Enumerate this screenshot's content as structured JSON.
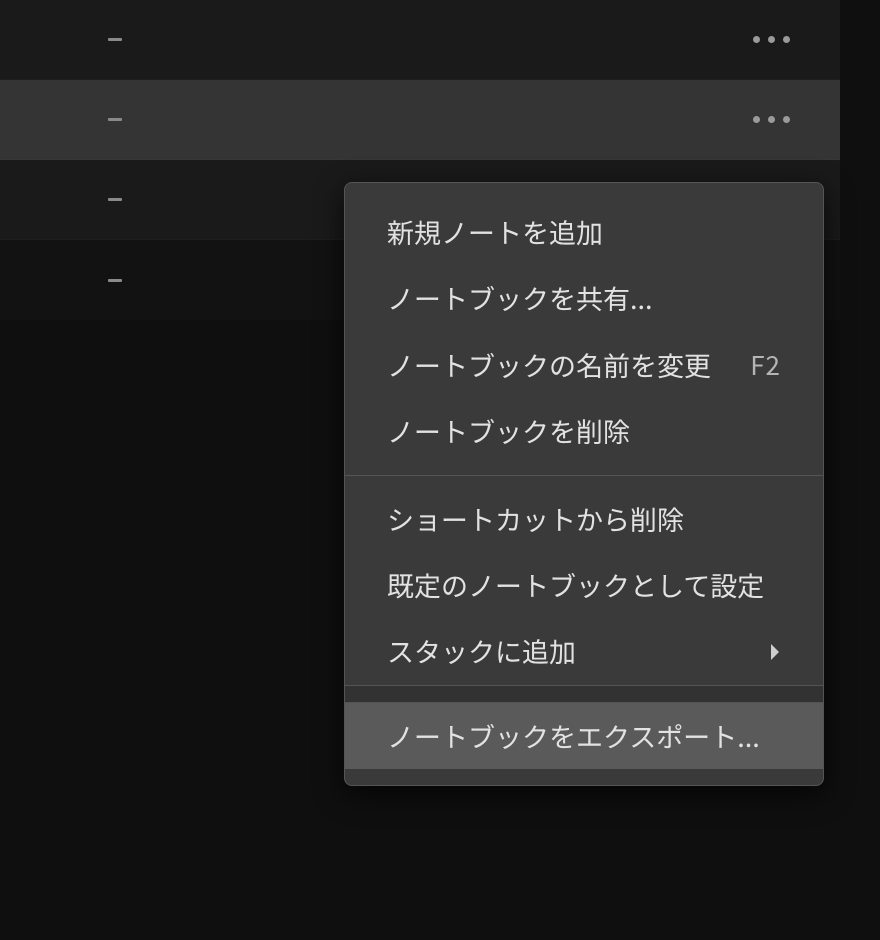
{
  "rows": {
    "count": 4,
    "highlighted_index": 1
  },
  "menu": {
    "items": [
      {
        "label": "新規ノートを追加",
        "shortcut": "",
        "submenu": false
      },
      {
        "label": "ノートブックを共有...",
        "shortcut": "",
        "submenu": false
      },
      {
        "label": "ノートブックの名前を変更",
        "shortcut": "F2",
        "submenu": false
      },
      {
        "label": "ノートブックを削除",
        "shortcut": "",
        "submenu": false
      }
    ],
    "items2": [
      {
        "label": "ショートカットから削除",
        "shortcut": "",
        "submenu": false
      },
      {
        "label": "既定のノートブックとして設定",
        "shortcut": "",
        "submenu": false
      },
      {
        "label": "スタックに追加",
        "shortcut": "",
        "submenu": true
      }
    ],
    "items3": [
      {
        "label": "ノートブックをエクスポート...",
        "shortcut": "",
        "submenu": false,
        "hover": true
      }
    ]
  }
}
